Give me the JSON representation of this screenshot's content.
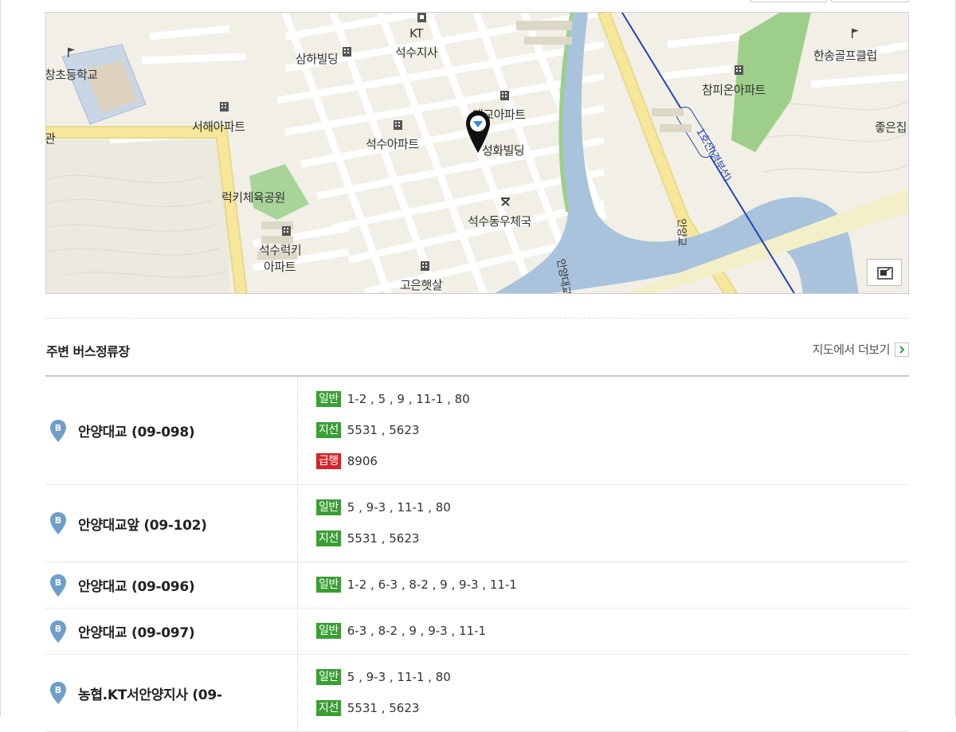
{
  "map": {
    "labels": {
      "kt": "KT",
      "kt_branch": "석수지사",
      "samha": "삼하빌딩",
      "school": "창초등학교",
      "seohae": "서해아파트",
      "gwan": "관",
      "daego": "대교아파트",
      "seoksu_apt": "석수아파트",
      "seonghwa": "성화빌딩",
      "park": "럭키체육공원",
      "post": "석수동우체국",
      "lucky1": "석수럭키",
      "lucky2": "아파트",
      "goeun": "고은햇살",
      "golf": "한송골프클럽",
      "champion": "참피온아파트",
      "joeun": "좋은집",
      "bridge_v": "안양교",
      "bridge_v2": "안양대교",
      "subway": "1호선(경부선)"
    },
    "colors": {
      "road_major": "#f7e79a",
      "river": "#a9c3dc",
      "park": "#9ecf8a",
      "subway": "#2145b5"
    }
  },
  "section": {
    "title": "주변 버스정류장",
    "more_label": "지도에서 더보기"
  },
  "stops": [
    {
      "name": "안양대교 (09-098)",
      "routes": [
        {
          "type": "일반",
          "color": "green",
          "text": "1-2 , 5 , 9 , 11-1 , 80"
        },
        {
          "type": "지선",
          "color": "green",
          "text": "5531 , 5623"
        },
        {
          "type": "급행",
          "color": "red",
          "text": "8906"
        }
      ]
    },
    {
      "name": "안양대교앞 (09-102)",
      "routes": [
        {
          "type": "일반",
          "color": "green",
          "text": "5 , 9-3 , 11-1 , 80"
        },
        {
          "type": "지선",
          "color": "green",
          "text": "5531 , 5623"
        }
      ]
    },
    {
      "name": "안양대교 (09-096)",
      "routes": [
        {
          "type": "일반",
          "color": "green",
          "text": "1-2 , 6-3 , 8-2 , 9 , 9-3 , 11-1"
        }
      ]
    },
    {
      "name": "안양대교 (09-097)",
      "routes": [
        {
          "type": "일반",
          "color": "green",
          "text": "6-3 , 8-2 , 9 , 9-3 , 11-1"
        }
      ]
    },
    {
      "name": "농협.KT서안양지사 (09-",
      "routes": [
        {
          "type": "일반",
          "color": "green",
          "text": "5 , 9-3 , 11-1 , 80"
        },
        {
          "type": "지선",
          "color": "green",
          "text": "5531 , 5623"
        }
      ]
    }
  ]
}
